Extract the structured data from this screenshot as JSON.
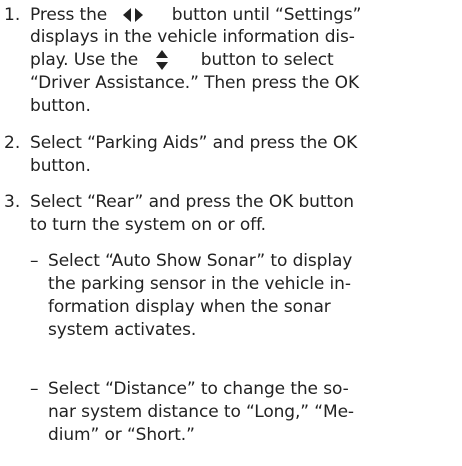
{
  "instructions": {
    "step1": {
      "number": "1.",
      "line1_a": "Press the",
      "line1_b": "button until “Settings”",
      "line2": "displays in the vehicle information dis-",
      "line3_a": "play. Use the",
      "line3_b": "button to select",
      "line4": "“Driver Assistance.” Then press the OK",
      "line5": "button.",
      "icon_left_right": "left-right-arrows-icon",
      "icon_up_down": "up-down-arrows-icon"
    },
    "step2": {
      "number": "2.",
      "line1": "Select “Parking Aids” and press the OK",
      "line2": "button."
    },
    "step3": {
      "number": "3.",
      "line1": "Select “Rear” and press the OK button",
      "line2": "to turn the system on or off."
    },
    "sub1": {
      "dash": "–",
      "line1": "Select “Auto Show Sonar” to display",
      "line2": "the parking sensor in the vehicle in-",
      "line3": "formation display when the sonar",
      "line4": "system activates."
    },
    "sub2": {
      "dash": "–",
      "line1": "Select “Distance” to change the so-",
      "line2": "nar system distance to “Long,” “Me-",
      "line3": "dium” or “Short.”"
    }
  },
  "colors": {
    "text": "#222222",
    "background": "#ffffff"
  }
}
